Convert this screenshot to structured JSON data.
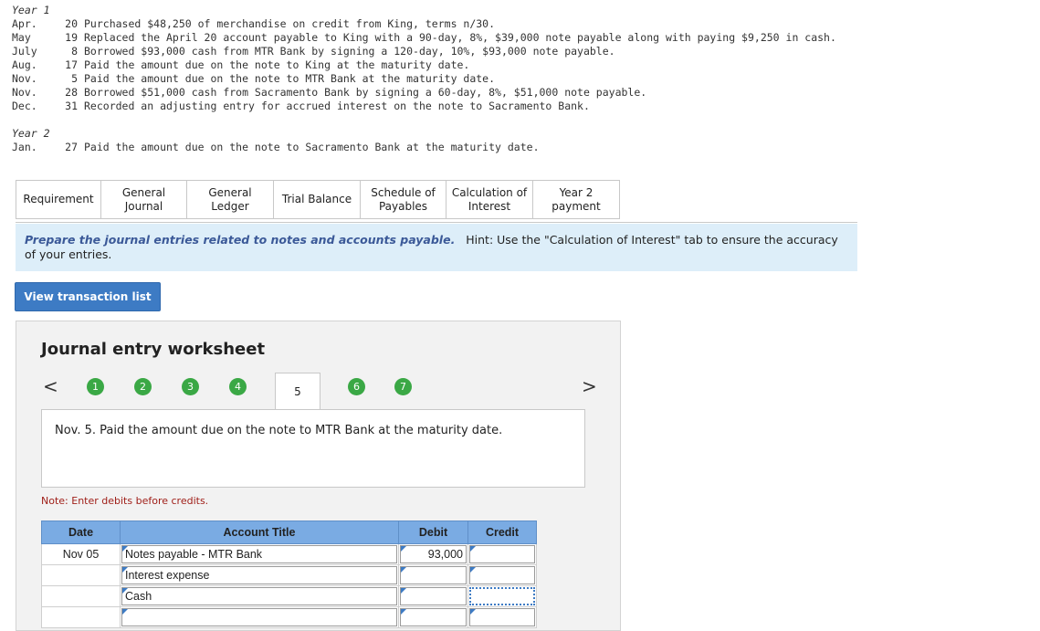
{
  "transactions": {
    "year1_label": "Year 1",
    "year1": [
      {
        "month": "Apr.",
        "day": "20",
        "text": "Purchased $48,250 of merchandise on credit from King, terms n/30."
      },
      {
        "month": "May",
        "day": "19",
        "text": "Replaced the April 20 account payable to King with a 90-day, 8%, $39,000 note payable along with paying $9,250 in cash."
      },
      {
        "month": "July",
        "day": "8",
        "text": "Borrowed $93,000 cash from MTR Bank by signing a 120-day, 10%, $93,000 note payable."
      },
      {
        "month": "Aug.",
        "day": "17",
        "text": "Paid the amount due on the note to King at the maturity date."
      },
      {
        "month": "Nov.",
        "day": "5",
        "text": "Paid the amount due on the note to MTR Bank at the maturity date."
      },
      {
        "month": "Nov.",
        "day": "28",
        "text": "Borrowed $51,000 cash from Sacramento Bank by signing a 60-day, 8%, $51,000 note payable."
      },
      {
        "month": "Dec.",
        "day": "31",
        "text": "Recorded an adjusting entry for accrued interest on the note to Sacramento Bank."
      }
    ],
    "year2_label": "Year 2",
    "year2": [
      {
        "month": "Jan.",
        "day": "27",
        "text": "Paid the amount due on the note to Sacramento Bank at the maturity date."
      }
    ]
  },
  "tabs": [
    {
      "line1": "Requirement",
      "line2": ""
    },
    {
      "line1": "General",
      "line2": "Journal"
    },
    {
      "line1": "General",
      "line2": "Ledger"
    },
    {
      "line1": "Trial Balance",
      "line2": ""
    },
    {
      "line1": "Schedule of",
      "line2": "Payables"
    },
    {
      "line1": "Calculation of",
      "line2": "Interest"
    },
    {
      "line1": "Year 2",
      "line2": "payment"
    }
  ],
  "instruction": {
    "main": "Prepare the journal entries related to notes and accounts payable.",
    "hint": "Hint:  Use the \"Calculation of Interest\" tab to ensure the accuracy of your entries."
  },
  "view_button": "View transaction list",
  "worksheet": {
    "title": "Journal entry worksheet",
    "prev": "<",
    "next": ">",
    "steps": [
      "1",
      "2",
      "3",
      "4",
      "5",
      "6",
      "7"
    ],
    "current_step": "5",
    "description": "Nov. 5. Paid the amount due on the note to MTR Bank at the maturity date.",
    "note": "Note: Enter debits before credits.",
    "headers": {
      "date": "Date",
      "account": "Account Title",
      "debit": "Debit",
      "credit": "Credit"
    },
    "rows": [
      {
        "date": "Nov 05",
        "account": "Notes payable - MTR Bank",
        "debit": "93,000",
        "credit": ""
      },
      {
        "date": "",
        "account": "Interest expense",
        "debit": "",
        "credit": ""
      },
      {
        "date": "",
        "account": "Cash",
        "debit": "",
        "credit": ""
      },
      {
        "date": "",
        "account": "",
        "debit": "",
        "credit": ""
      }
    ]
  },
  "colors": {
    "accent_blue": "#3d7bc4",
    "step_green": "#3aa845",
    "header_blue": "#7aabe3",
    "instruction_bg": "#ddeef9",
    "note_red": "#a0201a"
  }
}
